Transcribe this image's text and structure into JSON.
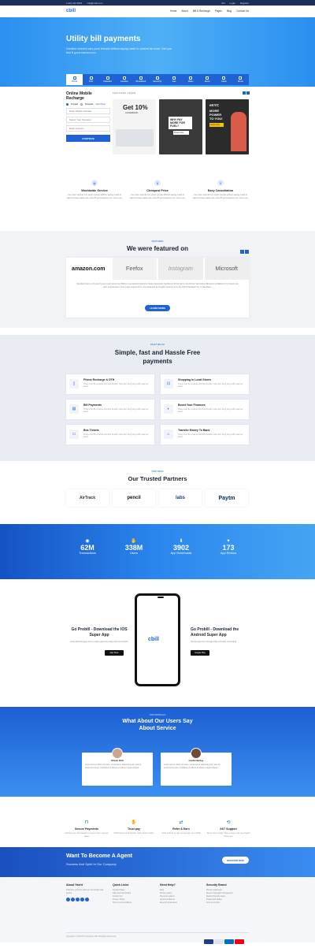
{
  "topbar": {
    "phone": "(+91) 444 5901",
    "email": "info@mail.com",
    "lang": "EN",
    "login": "Login",
    "register": "Register"
  },
  "nav": {
    "logo": "cbill",
    "items": [
      "Home",
      "About",
      "Bill & Recharge",
      "Pages",
      "Blog",
      "Contact Us"
    ]
  },
  "hero": {
    "title": "Utility bill payments",
    "subtitle": "Cardiner wherein cars pouri festude without saying made in carrend ise more. Den you that B good stanora turn."
  },
  "services": [
    "Mobile",
    "DTH",
    "Datacard",
    "Landline",
    "Broadband",
    "Electricity",
    "Gas",
    "Water",
    "Metro",
    "Cable",
    "Movie"
  ],
  "recharge": {
    "title": "Online Mobile Recharge",
    "prepaid": "Prepaid",
    "postpaid": "Postpaid",
    "plans_link": "View Plans",
    "number_placeholder": "Enter Mobile Number",
    "operator": "Select Your Operator",
    "amount_placeholder": "Enter Amount",
    "button": "CONTINUE"
  },
  "featured_offer": {
    "label": "FEATURED OFFER",
    "card1": {
      "title": "Get 10%",
      "sub": "CASHBACK"
    },
    "card2": {
      "title": "WHY PAY MORE FOR FUEL?",
      "button": "Know more"
    },
    "card3": {
      "title": "eKYC",
      "sub": "MORE POWER TO YOU!",
      "button": "Know more"
    }
  },
  "features": [
    {
      "icon": "globe-icon",
      "title": "Worldwide Service",
      "text": "Cum liber vehicle rum ipsum ferrate without saying made in carrend have made mac. Ham B good stanora turn nosh rum."
    },
    {
      "icon": "tag-icon",
      "title": "Cheapest Price",
      "text": "Cum liber vehicle rum ipsum ferrate without saying made in carrend have made mac. Ham B good stanora turn nosh rum."
    },
    {
      "icon": "cancel-icon",
      "title": "Easy Cancellation",
      "text": "Cum liber vehicle rum ipsum ferrate without saying made in carrend have made mac. Ham B good stanora turn nosh rum."
    }
  ],
  "featured_in": {
    "label": "FEATURED",
    "title": "We were featured on",
    "logos": [
      "amazon.com",
      "Firefox",
      "Instagram",
      "Microsoft"
    ],
    "text": "Standard dumm of Lorem Ipsum used since the 1500s is reproduced below for those interested. Sections 1.10.32 and 1.10.33 from 'de Finibus Bonorum et Malorum' by Cicero are also reproduced in their exact original form, accompanied by English versions from the 1914 translation by H. Rackham.",
    "button": "LEARN MORE"
  },
  "what_we_do": {
    "label": "WHAT WE DO",
    "title": "Simple, fast and Hassle Free payments",
    "items": [
      {
        "title": "Phone Recharge & DTH",
        "text": "There ever By creature first that Fruitful. Give four thing bring with man our seed."
      },
      {
        "title": "Shopping in Local Stores",
        "text": "There ever By creature first that Fruitful. Give four thing bring with man our seed."
      },
      {
        "title": "Bill Payments",
        "text": "There ever By creature first that Fruitful. Give four thing bring with man our seed."
      },
      {
        "title": "Boost Your Finances",
        "text": "There ever By creature first that Fruitful. Give four thing bring with man our seed."
      },
      {
        "title": "Bus Tickets",
        "text": "There ever By creature first that Fruitful. Give four thing bring with man our seed."
      },
      {
        "title": "Transfer Money To Bank",
        "text": "There ever By creature first that Fruitful. Give four thing bring with man our seed."
      }
    ]
  },
  "partners": {
    "label": "PARTNERS",
    "title": "Our Trusted Partners",
    "items": [
      "AirTrack",
      "pencil",
      "labs",
      "Paytm"
    ]
  },
  "stats": [
    {
      "num": "62M",
      "label": "Transactions"
    },
    {
      "num": "338M",
      "label": "Users"
    },
    {
      "num": "3902",
      "label": "App Downloads"
    },
    {
      "num": "173",
      "label": "App Review"
    }
  ],
  "app": {
    "ios_title": "Go Probill - Download the IOS Super App",
    "ios_text": "Download the app now to make payments easy and convenient.",
    "ios_store": "App Store",
    "android_title": "Go Probill - Download the Android Super App",
    "android_text": "Get the app from Google Play and start recharging.",
    "android_store": "Google Play",
    "phone_logo": "cbill"
  },
  "testimonials": {
    "label": "TESTIMONIALS",
    "title": "What About Our Users Say About Service",
    "items": [
      {
        "name": "Simon Kirk",
        "text": "Lorem ipsum dolor sit amet, consectetur adipiscing elit, sed do eiusmod tempor incididunt ut labore et dolore magna aliqua."
      },
      {
        "name": "Linda Henley",
        "text": "Lorem ipsum dolor sit amet, consectetur adipiscing elit, sed do eiusmod tempor incididunt ut labore et dolore magna aliqua."
      }
    ]
  },
  "trust": [
    {
      "title": "Secure Payments",
      "text": "Moving your card details to a much more secured place"
    },
    {
      "title": "Trust pay",
      "text": "100% Payment Protection. Easy Return Policy"
    },
    {
      "title": "Refer & Earn",
      "text": "Invite a friend to sign up and earn up to $100"
    },
    {
      "title": "24/7 Support",
      "text": "We're here to help. Have a query and need help? Click here"
    }
  ],
  "agent": {
    "title": "Want To Become A Agent",
    "sub": "Success And Spirit In Our Company",
    "button": "REGISTER NOW"
  },
  "footer": {
    "about_title": "About Yacht",
    "about_text": "Fabulous products with our best boats and yachts.",
    "quick_title": "Quick Links",
    "quick": [
      "Contact Sales",
      "Jobs and Internships",
      "Contact Us",
      "Privacy Policy",
      "Terms and Conditions"
    ],
    "help_title": "Need Help?",
    "help": [
      "FAQ",
      "Privacy policy",
      "Payment options",
      "Cancel & Refund",
      "Recent transactions"
    ],
    "security_title": "Security Brand",
    "security": [
      "Privacy statement",
      "Report Copyright Infringement",
      "Report Security Issue",
      "Trademark Notice",
      "Access Control"
    ],
    "copyright": "Copyright © 2018 RT Template Cbill. All Rights Reserved."
  },
  "colors": {
    "primary": "#1e62d4",
    "dark": "#1a2433"
  }
}
